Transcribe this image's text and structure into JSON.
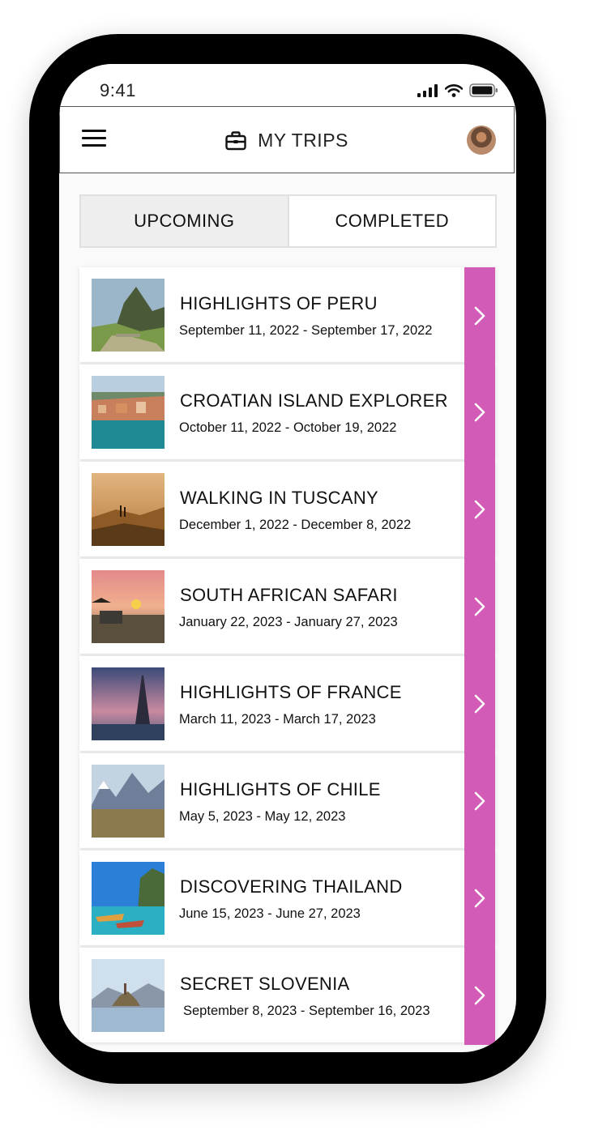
{
  "status_bar": {
    "time": "9:41"
  },
  "header": {
    "title": "MY TRIPS",
    "icons": {
      "menu": "hamburger-menu-icon",
      "title": "briefcase-icon",
      "avatar": "user-avatar"
    }
  },
  "tabs": [
    {
      "label": "UPCOMING",
      "active": true
    },
    {
      "label": "COMPLETED",
      "active": false
    }
  ],
  "colors": {
    "accent": "#d35bb8",
    "active_tab": "#eeeeee"
  },
  "trips": [
    {
      "title": "HIGHLIGHTS OF PERU",
      "dates": "September 11, 2022 - September 17, 2022",
      "image": "machu-picchu-photo"
    },
    {
      "title": "CROATIAN ISLAND EXPLORER",
      "dates": "October 11, 2022 - October 19, 2022",
      "image": "dubrovnik-harbor-photo"
    },
    {
      "title": "WALKING IN TUSCANY",
      "dates": "December 1, 2022 - December 8, 2022",
      "image": "tuscany-hills-photo"
    },
    {
      "title": "SOUTH AFRICAN SAFARI",
      "dates": "January 22, 2023 - January 27, 2023",
      "image": "safari-sunset-photo"
    },
    {
      "title": "HIGHLIGHTS OF FRANCE",
      "dates": "March 11, 2023 - March 17, 2023",
      "image": "eiffel-tower-photo"
    },
    {
      "title": "HIGHLIGHTS OF CHILE",
      "dates": "May 5, 2023 - May 12, 2023",
      "image": "patagonia-mountains-photo"
    },
    {
      "title": "DISCOVERING THAILAND",
      "dates": "June 15, 2023 - June 27, 2023",
      "image": "thai-longtail-boats-photo"
    },
    {
      "title": "SECRET SLOVENIA",
      "dates": "September 8, 2023 - September 16, 2023",
      "image": "lake-bled-photo"
    }
  ]
}
